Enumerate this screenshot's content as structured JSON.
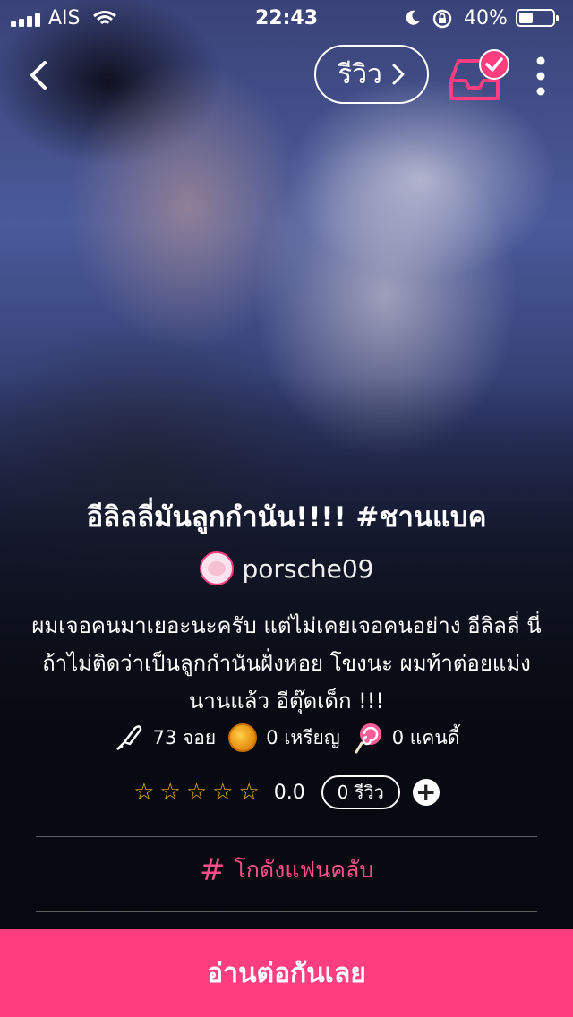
{
  "status_bar": {
    "carrier": "AIS",
    "time": "22:43",
    "battery_percent": "40%",
    "battery_level": 0.4
  },
  "nav": {
    "review_label": "รีวิว",
    "icons": [
      "back-chevron-icon",
      "library-inbox-icon",
      "more-vertical-icon"
    ]
  },
  "story": {
    "title": "อีลิลลี่มันลูกกำนัน!!!! #ชานแบค",
    "author": "porsche09",
    "description": "ผมเจอคนมาเยอะนะครับ แต่ไม่เคยเจอคนอย่าง อีลิลลี่ นี่ถ้าไม่ติดว่าเป็นลูกกำนันฝั่งหอย โขงนะ ผมท้าต่อยแม่งนานแล้ว อีตุ๊ดเด็ก !!!",
    "stats": {
      "chapters": "73 จอย",
      "coins": "0 เหรียญ",
      "candies": "0 แคนดี้"
    },
    "rating": {
      "stars_filled": 0,
      "stars_total": 5,
      "score": "0.0",
      "review_count_label": "0 รีวิว"
    },
    "fanclub_label": "โกดังแฟนคลับ"
  },
  "cta": {
    "label": "อ่านต่อกันเลย"
  },
  "colors": {
    "accent": "#ff3d7f",
    "star": "#f3b41b"
  }
}
